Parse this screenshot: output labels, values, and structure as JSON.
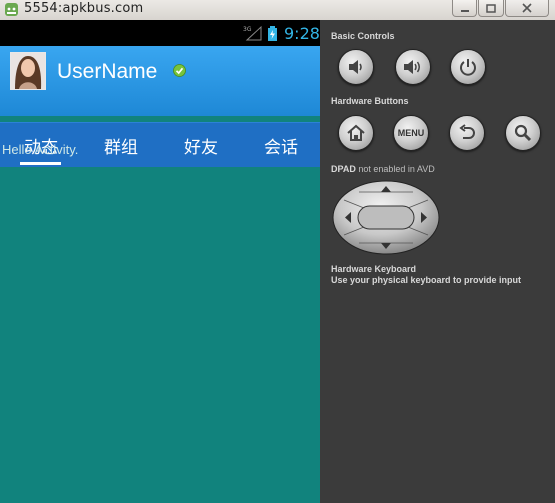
{
  "window": {
    "title": "5554:apkbus.com"
  },
  "statusbar": {
    "network_type": "3G",
    "time": "9:28"
  },
  "actionbar": {
    "username": "UserName"
  },
  "tabs": [
    {
      "label": "动态",
      "selected": true
    },
    {
      "label": "群组",
      "selected": false
    },
    {
      "label": "好友",
      "selected": false
    },
    {
      "label": "会话",
      "selected": false
    }
  ],
  "content": {
    "hello_text": "Hello Activity."
  },
  "controls": {
    "basic_title": "Basic Controls",
    "hardware_title": "Hardware Buttons",
    "menu_label": "MENU",
    "dpad_title": "DPAD",
    "dpad_note": "not enabled in AVD",
    "keyboard_title": "Hardware Keyboard",
    "keyboard_note": "Use your physical keyboard to provide input"
  },
  "colors": {
    "content_bg": "#11837d",
    "actionbar": "#2a96e6",
    "tabbar": "#1f6fc4",
    "clock": "#33b5e5",
    "panel_bg": "#3b3b3b"
  }
}
